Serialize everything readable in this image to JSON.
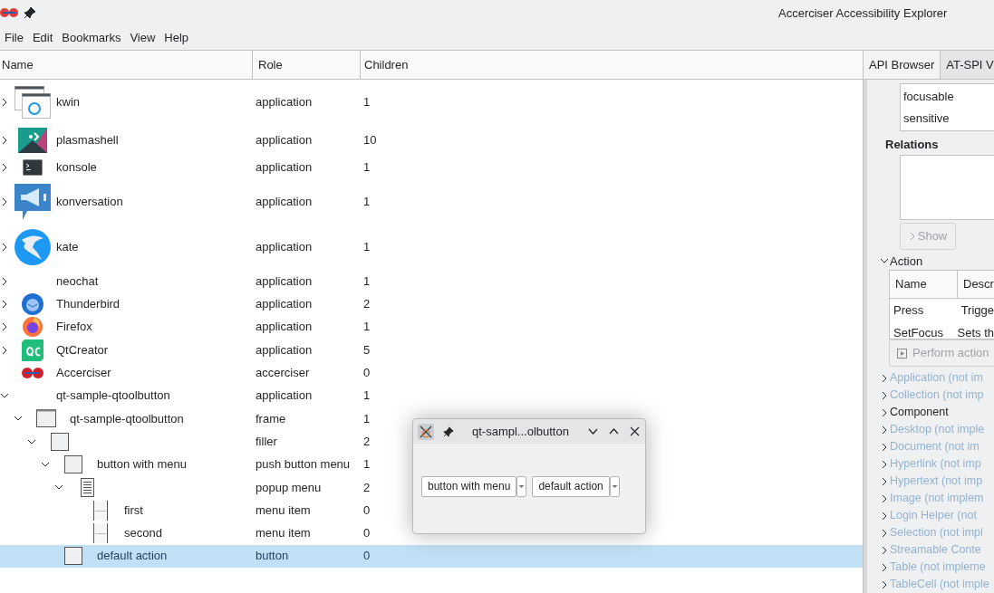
{
  "window": {
    "title": "Accerciser Accessibility Explorer"
  },
  "menu": [
    "File",
    "Edit",
    "Bookmarks",
    "View",
    "Help"
  ],
  "tree": {
    "columns": [
      "Name",
      "Role",
      "Children"
    ],
    "rows": [
      {
        "name": "kwin",
        "role": "application",
        "children_count": "1",
        "kind": "window-stack",
        "expanded": false,
        "selected": false
      },
      {
        "name": "plasmashell",
        "role": "application",
        "children_count": "10",
        "kind": "plasma",
        "expanded": false,
        "selected": false
      },
      {
        "name": "konsole",
        "role": "application",
        "children_count": "1",
        "kind": "terminal",
        "expanded": false,
        "selected": false
      },
      {
        "name": "konversation",
        "role": "application",
        "children_count": "1",
        "kind": "megaphone",
        "expanded": false,
        "selected": false
      },
      {
        "name": "kate",
        "role": "application",
        "children_count": "1",
        "kind": "bird",
        "expanded": false,
        "selected": false
      },
      {
        "name": "neochat",
        "role": "application",
        "children_count": "1",
        "kind": "plain",
        "expanded": false,
        "selected": false
      },
      {
        "name": "Thunderbird",
        "role": "application",
        "children_count": "2",
        "kind": "mail-bird",
        "expanded": false,
        "selected": false
      },
      {
        "name": "Firefox",
        "role": "application",
        "children_count": "1",
        "kind": "fox",
        "expanded": false,
        "selected": false
      },
      {
        "name": "QtCreator",
        "role": "application",
        "children_count": "5",
        "kind": "qc",
        "expanded": false,
        "selected": false
      },
      {
        "name": "Accerciser",
        "role": "accerciser",
        "children_count": "0",
        "kind": "dumbbell",
        "selected": false
      },
      {
        "name": "qt-sample-qtoolbutton",
        "role": "application",
        "children_count": "1",
        "kind": "plain",
        "expanded": true,
        "selected": false,
        "children": [
          {
            "name": "qt-sample-qtoolbutton",
            "role": "frame",
            "children_count": "1",
            "kind": "frame",
            "expanded": true,
            "selected": false,
            "children": [
              {
                "role": "filler",
                "children_count": "2",
                "kind": "square",
                "expanded": true,
                "selected": false,
                "children": [
                  {
                    "name": "button with menu",
                    "role": "push button menu",
                    "children_count": "1",
                    "kind": "square",
                    "expanded": true,
                    "selected": false,
                    "children": [
                      {
                        "role": "popup menu",
                        "children_count": "2",
                        "kind": "list",
                        "expanded": true,
                        "selected": false,
                        "children": [
                          {
                            "name": "first",
                            "role": "menu item",
                            "children_count": "0",
                            "kind": "menu-item",
                            "selected": false
                          },
                          {
                            "name": "second",
                            "role": "menu item",
                            "children_count": "0",
                            "kind": "menu-item",
                            "selected": false
                          }
                        ]
                      }
                    ]
                  },
                  {
                    "name": "default action",
                    "role": "button",
                    "children_count": "0",
                    "kind": "square",
                    "selected": true
                  }
                ]
              }
            ]
          }
        ]
      }
    ]
  },
  "side_panel": {
    "tabs": [
      {
        "label": "API Browser",
        "selected": true
      },
      {
        "label": "AT-SPI V",
        "selected": false
      }
    ],
    "states": [
      "focusable",
      "sensitive"
    ],
    "relations_heading": "Relations",
    "show_button": {
      "label": "Show",
      "disabled": true
    },
    "action_section": {
      "label": "Action",
      "expanded": true,
      "columns": [
        "Name",
        "Descr"
      ],
      "rows": [
        [
          "Press",
          "Trigge"
        ],
        [
          "SetFocus",
          "Sets th"
        ]
      ],
      "perform_button": {
        "label": "Perform action",
        "disabled": true
      }
    },
    "interfaces": [
      {
        "label": "Application (not im",
        "disabled": true
      },
      {
        "label": "Collection (not imp",
        "disabled": true
      },
      {
        "label": "Component",
        "disabled": false
      },
      {
        "label": "Desktop (not imple",
        "disabled": true
      },
      {
        "label": "Document (not im",
        "disabled": true
      },
      {
        "label": "Hyperlink (not imp",
        "disabled": true
      },
      {
        "label": "Hypertext (not imp",
        "disabled": true
      },
      {
        "label": "Image (not implem",
        "disabled": true
      },
      {
        "label": "Login Helper (not",
        "disabled": true
      },
      {
        "label": "Selection (not impl",
        "disabled": true
      },
      {
        "label": "Streamable Conte",
        "disabled": true
      },
      {
        "label": "Table (not impleme",
        "disabled": true
      },
      {
        "label": "TableCell (not imple",
        "disabled": true
      }
    ]
  },
  "floating_window": {
    "title": "qt-sampl...olbutton",
    "buttons": [
      "button with menu",
      "default action"
    ]
  }
}
